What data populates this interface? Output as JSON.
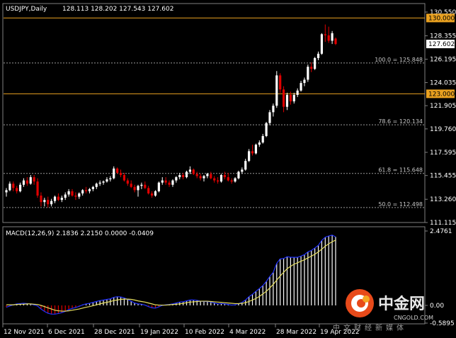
{
  "header": {
    "symbol": "USDJPY,Daily",
    "ohlc": "128.113 128.202 127.543 127.602"
  },
  "macd_header": "MACD(12,26,9) 2.1836 2.2150 0.0000 -0.0409",
  "price_axis": {
    "labels": [
      "130.550",
      "128.355",
      "126.195",
      "124.035",
      "121.905",
      "119.760",
      "117.595",
      "115.455",
      "113.260",
      "111.115"
    ],
    "tags": [
      {
        "text": "130.000",
        "value": 130.0
      },
      {
        "text": "127.602",
        "value": 127.602
      },
      {
        "text": "123.000",
        "value": 123.0
      }
    ]
  },
  "macd_axis": {
    "labels": [
      "2.4761",
      "0.00",
      "-0.5895"
    ]
  },
  "date_axis": [
    "12 Nov 2021",
    "6 Dec 2021",
    "28 Dec 2021",
    "19 Jan 2022",
    "10 Feb 2022",
    "4 Mar 2022",
    "28 Mar 2022",
    "19 Apr 2022"
  ],
  "levels": [
    {
      "label": "130.000",
      "value": 130.0,
      "style": "solid",
      "color": "#e8a020"
    },
    {
      "label": "123.000",
      "value": 123.0,
      "style": "solid",
      "color": "#e8a020"
    },
    {
      "label": "100.0 = 125.848",
      "value": 125.848,
      "style": "dotted",
      "color": "#9a9a9a"
    },
    {
      "label": "78.6 = 120.134",
      "value": 120.134,
      "style": "dotted",
      "color": "#9a9a9a"
    },
    {
      "label": "61.8 = 115.648",
      "value": 115.648,
      "style": "dotted",
      "color": "#9a9a9a"
    },
    {
      "label": "50.0 = 112.498",
      "value": 112.498,
      "style": "dotted",
      "color": "#9a9a9a"
    }
  ],
  "watermark": {
    "cn": "中金网",
    "en": "CNGOLD.COM",
    "sub": "中文财经新媒体"
  },
  "colors": {
    "up": "#ffffff",
    "down": "#e00000",
    "macd_line": "#2233ff",
    "signal_line": "#e8e060",
    "level": "#e8a020",
    "grid": "#9a9a9a"
  },
  "chart_data": {
    "type": "candlestick",
    "ylim": [
      111.115,
      130.55
    ],
    "macd_ylim": [
      -0.5895,
      2.4761
    ],
    "candles": [
      [
        113.9,
        114.3,
        113.5,
        114.1
      ],
      [
        114.1,
        114.9,
        114.0,
        114.7
      ],
      [
        114.7,
        114.9,
        114.0,
        114.3
      ],
      [
        114.3,
        114.5,
        113.8,
        114.0
      ],
      [
        114.0,
        114.8,
        113.9,
        114.6
      ],
      [
        114.6,
        115.2,
        114.4,
        115.0
      ],
      [
        115.0,
        115.3,
        114.5,
        114.7
      ],
      [
        114.7,
        115.5,
        114.6,
        115.3
      ],
      [
        115.3,
        115.5,
        114.6,
        114.9
      ],
      [
        114.9,
        115.2,
        113.4,
        113.6
      ],
      [
        113.6,
        113.9,
        112.6,
        113.0
      ],
      [
        113.0,
        113.4,
        112.6,
        113.2
      ],
      [
        113.2,
        113.5,
        112.5,
        112.8
      ],
      [
        112.8,
        113.3,
        112.6,
        113.1
      ],
      [
        113.1,
        113.6,
        112.9,
        113.5
      ],
      [
        113.5,
        113.8,
        113.1,
        113.2
      ],
      [
        113.2,
        113.6,
        113.0,
        113.4
      ],
      [
        113.4,
        113.9,
        113.2,
        113.7
      ],
      [
        113.7,
        114.2,
        113.5,
        114.0
      ],
      [
        114.0,
        114.2,
        113.5,
        113.6
      ],
      [
        113.6,
        113.9,
        113.2,
        113.5
      ],
      [
        113.5,
        113.9,
        113.3,
        113.8
      ],
      [
        113.8,
        114.2,
        113.6,
        114.1
      ],
      [
        114.1,
        114.4,
        113.8,
        114.0
      ],
      [
        114.0,
        114.3,
        113.8,
        114.2
      ],
      [
        114.2,
        114.5,
        114.0,
        114.4
      ],
      [
        114.4,
        114.8,
        114.2,
        114.7
      ],
      [
        114.7,
        115.0,
        114.5,
        114.8
      ],
      [
        114.8,
        115.0,
        114.6,
        114.9
      ],
      [
        114.9,
        115.3,
        114.8,
        115.1
      ],
      [
        115.1,
        115.4,
        114.9,
        115.2
      ],
      [
        115.2,
        116.3,
        115.1,
        116.1
      ],
      [
        116.1,
        116.2,
        115.6,
        115.7
      ],
      [
        115.7,
        116.0,
        115.3,
        115.5
      ],
      [
        115.5,
        115.7,
        114.9,
        115.0
      ],
      [
        115.0,
        115.2,
        114.5,
        114.7
      ],
      [
        114.7,
        115.0,
        114.3,
        114.4
      ],
      [
        114.4,
        114.6,
        113.9,
        114.1
      ],
      [
        114.1,
        114.6,
        113.5,
        114.5
      ],
      [
        114.5,
        114.8,
        114.2,
        114.6
      ],
      [
        114.6,
        114.9,
        114.2,
        114.3
      ],
      [
        114.3,
        114.5,
        113.7,
        113.8
      ],
      [
        113.8,
        114.0,
        113.4,
        113.6
      ],
      [
        113.6,
        114.1,
        113.5,
        114.0
      ],
      [
        114.0,
        114.9,
        113.9,
        114.8
      ],
      [
        114.8,
        115.3,
        114.6,
        115.0
      ],
      [
        115.0,
        115.3,
        114.6,
        114.8
      ],
      [
        114.8,
        115.0,
        114.4,
        114.6
      ],
      [
        114.6,
        115.1,
        114.4,
        115.0
      ],
      [
        115.0,
        115.4,
        114.8,
        115.3
      ],
      [
        115.3,
        115.7,
        115.1,
        115.5
      ],
      [
        115.5,
        115.7,
        115.1,
        115.3
      ],
      [
        115.3,
        115.9,
        115.2,
        115.8
      ],
      [
        115.8,
        116.3,
        115.6,
        116.0
      ],
      [
        116.0,
        116.1,
        115.5,
        115.6
      ],
      [
        115.6,
        115.8,
        115.2,
        115.4
      ],
      [
        115.4,
        115.6,
        115.0,
        115.2
      ],
      [
        115.2,
        115.5,
        114.9,
        115.4
      ],
      [
        115.4,
        115.7,
        115.2,
        115.6
      ],
      [
        115.6,
        115.8,
        115.1,
        115.2
      ],
      [
        115.2,
        115.4,
        114.8,
        115.0
      ],
      [
        115.0,
        115.3,
        114.7,
        114.9
      ],
      [
        114.9,
        115.6,
        114.8,
        115.5
      ],
      [
        115.5,
        115.8,
        115.1,
        115.3
      ],
      [
        115.3,
        115.7,
        114.9,
        115.0
      ],
      [
        115.0,
        115.2,
        114.7,
        114.9
      ],
      [
        114.9,
        115.3,
        114.8,
        115.2
      ],
      [
        115.2,
        115.9,
        115.1,
        115.8
      ],
      [
        115.8,
        116.2,
        115.6,
        116.0
      ],
      [
        116.0,
        117.0,
        115.9,
        116.8
      ],
      [
        116.8,
        117.9,
        116.7,
        117.7
      ],
      [
        117.7,
        118.3,
        117.3,
        117.5
      ],
      [
        117.5,
        118.4,
        117.4,
        118.3
      ],
      [
        118.3,
        118.7,
        118.1,
        118.5
      ],
      [
        118.5,
        119.3,
        118.4,
        119.1
      ],
      [
        119.1,
        120.4,
        119.0,
        120.3
      ],
      [
        120.3,
        121.5,
        120.1,
        121.3
      ],
      [
        121.3,
        122.1,
        120.9,
        121.9
      ],
      [
        121.9,
        125.1,
        121.7,
        124.7
      ],
      [
        124.7,
        124.9,
        123.1,
        123.4
      ],
      [
        123.4,
        123.7,
        121.3,
        121.8
      ],
      [
        121.8,
        123.1,
        121.5,
        122.9
      ],
      [
        122.9,
        123.2,
        122.0,
        122.3
      ],
      [
        122.3,
        123.1,
        122.1,
        122.9
      ],
      [
        122.9,
        123.5,
        122.7,
        123.3
      ],
      [
        123.3,
        124.2,
        123.2,
        124.0
      ],
      [
        124.0,
        124.5,
        123.7,
        124.3
      ],
      [
        124.3,
        125.7,
        124.1,
        125.5
      ],
      [
        125.5,
        125.9,
        125.0,
        125.3
      ],
      [
        125.3,
        126.4,
        125.2,
        126.3
      ],
      [
        126.3,
        126.9,
        126.1,
        126.7
      ],
      [
        126.7,
        128.6,
        126.6,
        128.5
      ],
      [
        128.5,
        129.4,
        127.8,
        128.4
      ],
      [
        128.4,
        129.2,
        127.7,
        127.9
      ],
      [
        127.9,
        128.8,
        127.6,
        128.6
      ],
      [
        128.1,
        128.2,
        127.5,
        127.6
      ]
    ],
    "macd": [
      -0.06,
      -0.02,
      0.02,
      0.05,
      0.06,
      0.07,
      0.06,
      0.04,
      0.02,
      -0.02,
      -0.12,
      -0.2,
      -0.26,
      -0.29,
      -0.29,
      -0.27,
      -0.24,
      -0.2,
      -0.14,
      -0.1,
      -0.07,
      -0.03,
      0.02,
      0.05,
      0.07,
      0.1,
      0.13,
      0.16,
      0.18,
      0.2,
      0.22,
      0.27,
      0.29,
      0.28,
      0.25,
      0.2,
      0.14,
      0.08,
      0.05,
      0.04,
      0.01,
      -0.04,
      -0.08,
      -0.09,
      -0.05,
      0.0,
      0.02,
      0.03,
      0.05,
      0.08,
      0.11,
      0.12,
      0.15,
      0.18,
      0.18,
      0.17,
      0.14,
      0.13,
      0.13,
      0.11,
      0.08,
      0.05,
      0.06,
      0.05,
      0.03,
      0.01,
      0.02,
      0.06,
      0.1,
      0.18,
      0.29,
      0.37,
      0.47,
      0.56,
      0.66,
      0.8,
      0.96,
      1.1,
      1.4,
      1.55,
      1.56,
      1.62,
      1.6,
      1.6,
      1.6,
      1.64,
      1.69,
      1.78,
      1.83,
      1.91,
      2.0,
      2.16,
      2.27,
      2.31,
      2.34,
      2.28
    ],
    "signal": [
      0.02,
      0.02,
      0.02,
      0.03,
      0.04,
      0.04,
      0.05,
      0.05,
      0.04,
      0.03,
      0.0,
      -0.04,
      -0.08,
      -0.12,
      -0.16,
      -0.18,
      -0.19,
      -0.19,
      -0.18,
      -0.16,
      -0.14,
      -0.12,
      -0.09,
      -0.06,
      -0.04,
      -0.01,
      0.02,
      0.05,
      0.08,
      0.1,
      0.13,
      0.16,
      0.18,
      0.2,
      0.21,
      0.21,
      0.2,
      0.18,
      0.15,
      0.13,
      0.11,
      0.08,
      0.05,
      0.02,
      0.01,
      0.01,
      0.01,
      0.02,
      0.03,
      0.04,
      0.05,
      0.07,
      0.09,
      0.11,
      0.12,
      0.13,
      0.14,
      0.14,
      0.14,
      0.13,
      0.12,
      0.11,
      0.1,
      0.09,
      0.08,
      0.07,
      0.06,
      0.06,
      0.07,
      0.09,
      0.13,
      0.18,
      0.23,
      0.3,
      0.38,
      0.47,
      0.58,
      0.7,
      0.84,
      0.98,
      1.1,
      1.22,
      1.3,
      1.37,
      1.42,
      1.47,
      1.52,
      1.58,
      1.64,
      1.7,
      1.78,
      1.87,
      1.97,
      2.05,
      2.12,
      2.17
    ]
  }
}
